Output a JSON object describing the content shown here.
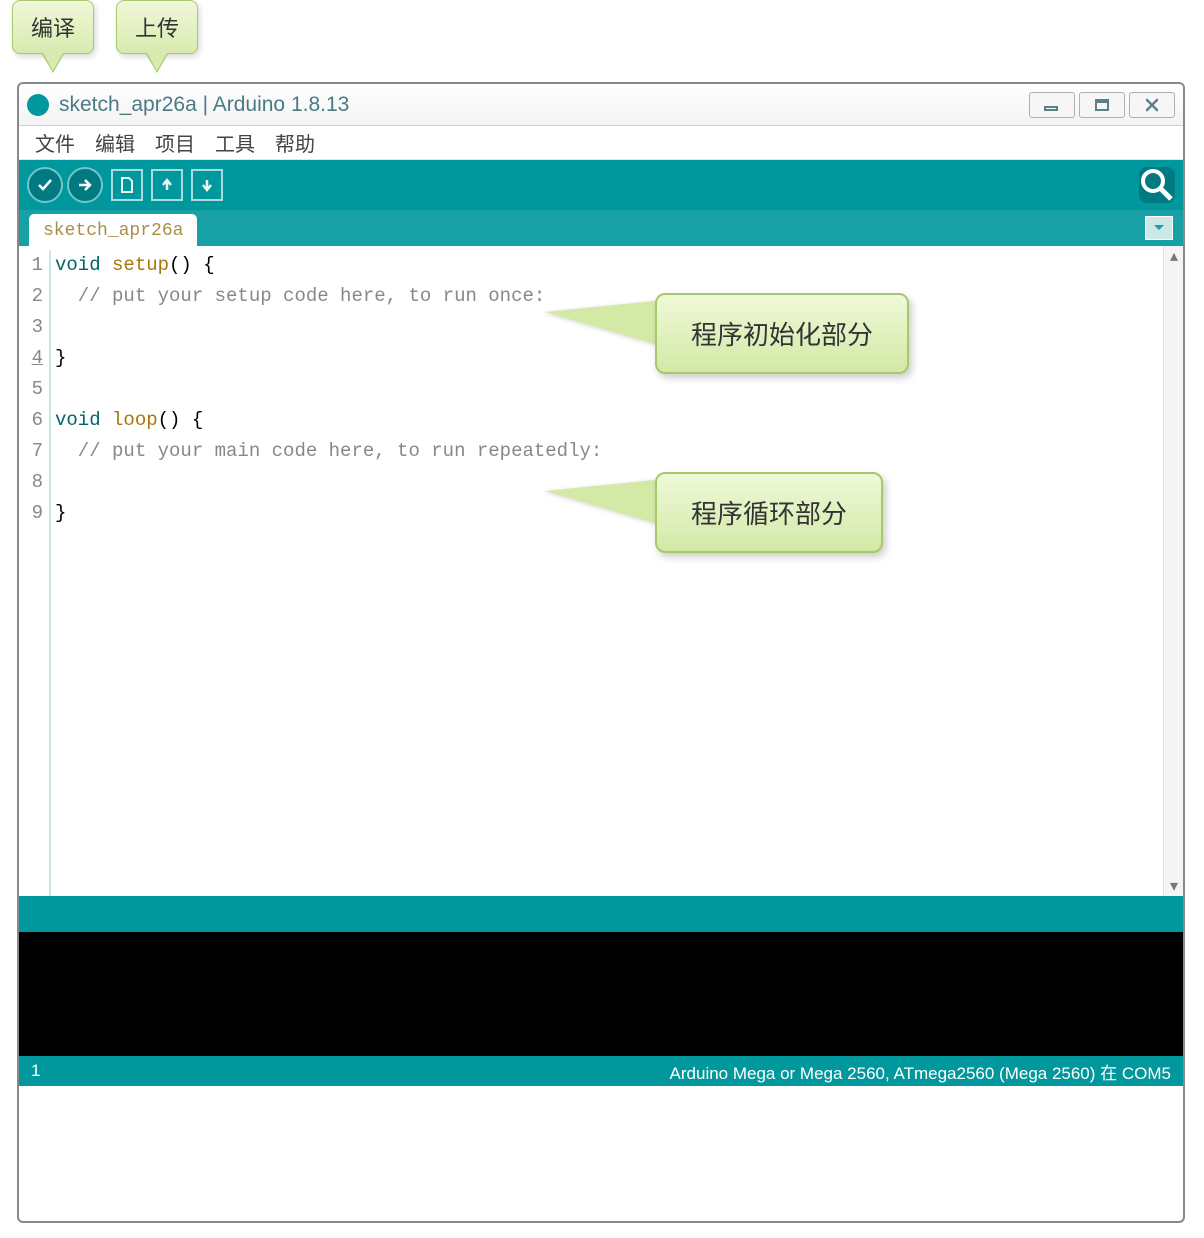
{
  "top_callouts": {
    "compile": "编译",
    "upload": "上传"
  },
  "window": {
    "title": "sketch_apr26a | Arduino 1.8.13"
  },
  "menu": {
    "file": "文件",
    "edit": "编辑",
    "sketch": "项目",
    "tools": "工具",
    "help": "帮助"
  },
  "tab": {
    "name": "sketch_apr26a"
  },
  "code": {
    "lines": [
      "1",
      "2",
      "3",
      "4",
      "5",
      "6",
      "7",
      "8",
      "9"
    ],
    "l1_kw": "void",
    "l1_fn": "setup",
    "l1_rest": "() {",
    "l2": "  // put your setup code here, to run once:",
    "l4": "}",
    "l6_kw": "void",
    "l6_fn": "loop",
    "l6_rest": "() {",
    "l7": "  // put your main code here, to run repeatedly:",
    "l9": "}"
  },
  "side_callouts": {
    "setup": "程序初始化部分",
    "loop": "程序循环部分"
  },
  "footer": {
    "line": "1",
    "board": "Arduino Mega or Mega 2560, ATmega2560 (Mega 2560) 在 COM5"
  }
}
